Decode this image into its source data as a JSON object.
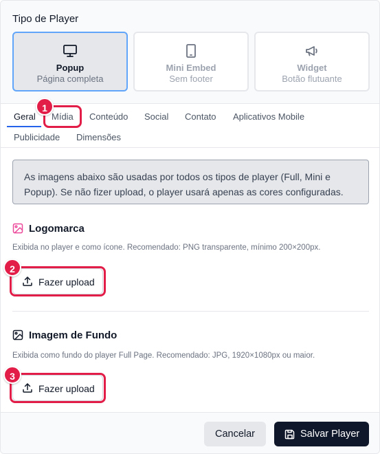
{
  "player_type": {
    "title": "Tipo de Player",
    "options": [
      {
        "title": "Popup",
        "subtitle": "Página completa",
        "icon": "monitor-icon",
        "selected": true
      },
      {
        "title": "Mini Embed",
        "subtitle": "Sem footer",
        "icon": "tablet-icon",
        "selected": false
      },
      {
        "title": "Widget",
        "subtitle": "Botão flutuante",
        "icon": "megaphone-icon",
        "selected": false
      }
    ]
  },
  "tabs": [
    {
      "label": "Geral",
      "active": true
    },
    {
      "label": "Mídia",
      "active": false
    },
    {
      "label": "Conteúdo",
      "active": false
    },
    {
      "label": "Social",
      "active": false
    },
    {
      "label": "Contato",
      "active": false
    },
    {
      "label": "Aplicativos Mobile",
      "active": false
    },
    {
      "label": "Publicidade",
      "active": false
    },
    {
      "label": "Dimensões",
      "active": false
    }
  ],
  "info_text": "As imagens abaixo são usadas por todos os tipos de player (Full, Mini e Popup). Se não fizer upload, o player usará apenas as cores configuradas.",
  "fields": {
    "logo": {
      "title": "Logomarca",
      "description": "Exibida no player e como ícone. Recomendado: PNG transparente, mínimo 200×200px.",
      "button_label": "Fazer upload",
      "icon": "image-icon",
      "icon_color": "#ec4899"
    },
    "background": {
      "title": "Imagem de Fundo",
      "description": "Exibida como fundo do player Full Page. Recomendado: JPG, 1920×1080px ou maior.",
      "button_label": "Fazer upload",
      "icon": "image-icon",
      "icon_color": "#111827"
    }
  },
  "annotations": [
    "1",
    "2",
    "3"
  ],
  "footer": {
    "cancel_label": "Cancelar",
    "save_label": "Salvar Player"
  },
  "colors": {
    "accent": "#2563eb",
    "selected_border": "#60a5fa",
    "highlight": "#e11d48",
    "primary_button": "#0f172a"
  }
}
